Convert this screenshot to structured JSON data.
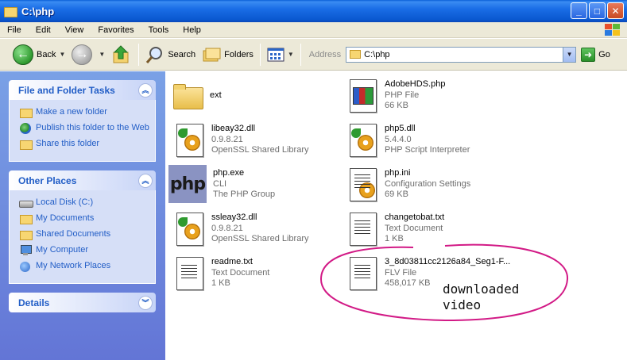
{
  "window": {
    "title": "C:\\php",
    "buttons": {
      "minimize": "_",
      "maximize": "□",
      "close": "✕"
    }
  },
  "menu": [
    "File",
    "Edit",
    "View",
    "Favorites",
    "Tools",
    "Help"
  ],
  "toolbar": {
    "back_label": "Back",
    "forward_label": "",
    "search_label": "Search",
    "folders_label": "Folders",
    "address_label": "Address",
    "address_value": "C:\\php",
    "go_label": "Go"
  },
  "sidebar": {
    "tasks": {
      "title": "File and Folder Tasks",
      "items": [
        {
          "label": "Make a new folder",
          "icon": "new-folder-icon"
        },
        {
          "label": "Publish this folder to the Web",
          "icon": "publish-web-icon"
        },
        {
          "label": "Share this folder",
          "icon": "share-folder-icon"
        }
      ]
    },
    "other_places": {
      "title": "Other Places",
      "items": [
        {
          "label": "Local Disk (C:)",
          "icon": "disk-icon"
        },
        {
          "label": "My Documents",
          "icon": "folder-icon"
        },
        {
          "label": "Shared Documents",
          "icon": "folder-icon"
        },
        {
          "label": "My Computer",
          "icon": "computer-icon"
        },
        {
          "label": "My Network Places",
          "icon": "network-icon"
        }
      ]
    },
    "details": {
      "title": "Details"
    }
  },
  "files": [
    {
      "name": "ext",
      "line2": "",
      "line3": "",
      "icon": "folder-icon"
    },
    {
      "name": "AdobeHDS.php",
      "line2": "PHP File",
      "line3": "66 KB",
      "icon": "php-file-icon"
    },
    {
      "name": "libeay32.dll",
      "line2": "0.9.8.21",
      "line3": "OpenSSL Shared Library",
      "icon": "dll-icon"
    },
    {
      "name": "php5.dll",
      "line2": "5.4.4.0",
      "line3": "PHP Script Interpreter",
      "icon": "dll-icon"
    },
    {
      "name": "php.exe",
      "line2": "CLI",
      "line3": "The PHP Group",
      "icon": "php-exe-icon"
    },
    {
      "name": "php.ini",
      "line2": "Configuration Settings",
      "line3": "69 KB",
      "icon": "ini-file-icon"
    },
    {
      "name": "ssleay32.dll",
      "line2": "0.9.8.21",
      "line3": "OpenSSL Shared Library",
      "icon": "dll-icon"
    },
    {
      "name": "changetobat.txt",
      "line2": "Text Document",
      "line3": "1 KB",
      "icon": "text-file-icon"
    },
    {
      "name": "readme.txt",
      "line2": "Text Document",
      "line3": "1 KB",
      "icon": "text-file-icon"
    },
    {
      "name": "3_8d03811cc2126a84_Seg1-F...",
      "line2": "FLV File",
      "line3": "458,017 KB",
      "icon": "flv-file-icon"
    }
  ],
  "annotation": {
    "line1": "downloaded",
    "line2": "video",
    "color": "#d21a86"
  },
  "colors": {
    "titlebar": "#0a58d0",
    "sidebar": "#6d8ce0",
    "link": "#215dc6"
  }
}
